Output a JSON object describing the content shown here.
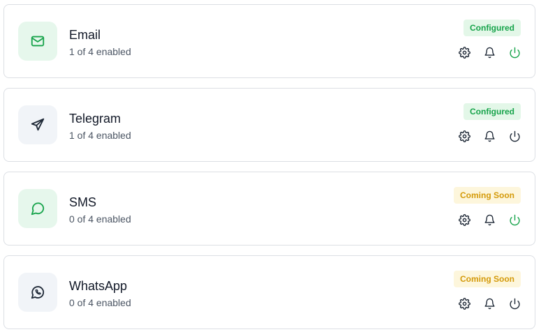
{
  "channels": [
    {
      "name": "Email",
      "status": "1 of 4 enabled",
      "badge": "Configured",
      "icon": "mail-icon"
    },
    {
      "name": "Telegram",
      "status": "1 of 4 enabled",
      "badge": "Configured",
      "icon": "send-icon"
    },
    {
      "name": "SMS",
      "status": "0 of 4 enabled",
      "badge": "Coming Soon",
      "icon": "message-circle-icon"
    },
    {
      "name": "WhatsApp",
      "status": "0 of 4 enabled",
      "badge": "Coming Soon",
      "icon": "whatsapp-icon"
    }
  ],
  "colors": {
    "accent_green": "#16a34a",
    "configured_bg": "#e3f7e8",
    "soon_text": "#d49a0a",
    "soon_bg": "#fdf6dc"
  }
}
